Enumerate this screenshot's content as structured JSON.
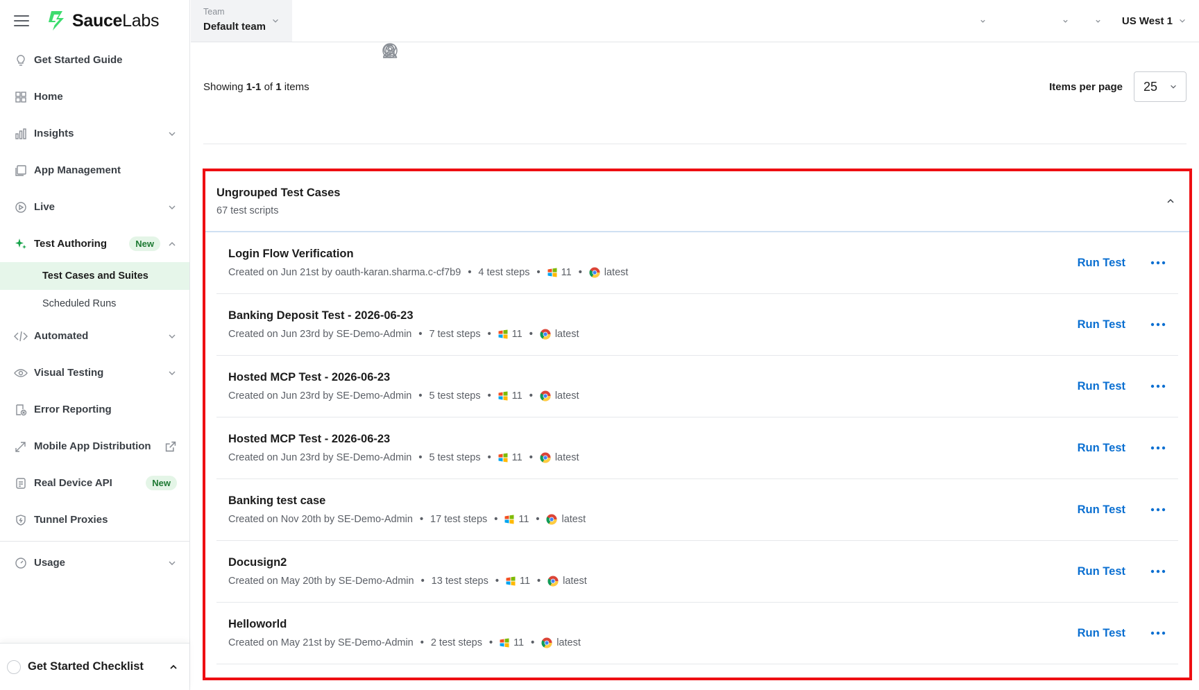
{
  "brand": {
    "name_prefix": "Sauce",
    "name_suffix": "Labs"
  },
  "sidebar": {
    "items": [
      {
        "label": "Get Started Guide"
      },
      {
        "label": "Home"
      },
      {
        "label": "Insights"
      },
      {
        "label": "App Management"
      },
      {
        "label": "Live"
      },
      {
        "label": "Test Authoring",
        "badge": "New"
      },
      {
        "label": "Automated"
      },
      {
        "label": "Visual Testing"
      },
      {
        "label": "Error Reporting"
      },
      {
        "label": "Mobile App Distribution"
      },
      {
        "label": "Real Device API",
        "badge": "New"
      },
      {
        "label": "Tunnel Proxies"
      },
      {
        "label": "Usage"
      }
    ],
    "sub_items": [
      {
        "label": "Test Cases and Suites",
        "active": true
      },
      {
        "label": "Scheduled Runs"
      }
    ],
    "checklist_label": "Get Started Checklist"
  },
  "topbar": {
    "team_label": "Team",
    "team_value": "Default team",
    "region": "US West 1"
  },
  "list": {
    "showing_prefix": "Showing",
    "range": "1-1",
    "of": "of",
    "total": "1",
    "items_word": "items",
    "items_per_page_label": "Items per page",
    "items_per_page_value": "25"
  },
  "group": {
    "title": "Ungrouped Test Cases",
    "subtitle": "67 test scripts"
  },
  "run_label": "Run Test",
  "tests": [
    {
      "name": "Login Flow Verification",
      "created": "Created on Jun 21st by oauth-karan.sharma.c-cf7b9",
      "steps": "4 test steps",
      "os": "11",
      "browser": "latest"
    },
    {
      "name": "Banking Deposit Test - 2026-06-23",
      "created": "Created on Jun 23rd by SE-Demo-Admin",
      "steps": "7 test steps",
      "os": "11",
      "browser": "latest"
    },
    {
      "name": "Hosted MCP Test - 2026-06-23",
      "created": "Created on Jun 23rd by SE-Demo-Admin",
      "steps": "5 test steps",
      "os": "11",
      "browser": "latest"
    },
    {
      "name": "Hosted MCP Test - 2026-06-23",
      "created": "Created on Jun 23rd by SE-Demo-Admin",
      "steps": "5 test steps",
      "os": "11",
      "browser": "latest"
    },
    {
      "name": "Banking test case",
      "created": "Created on Nov 20th by SE-Demo-Admin",
      "steps": "17 test steps",
      "os": "11",
      "browser": "latest"
    },
    {
      "name": "Docusign2",
      "created": "Created on May 20th by SE-Demo-Admin",
      "steps": "13 test steps",
      "os": "11",
      "browser": "latest"
    },
    {
      "name": "Helloworld",
      "created": "Created on May 21st by SE-Demo-Admin",
      "steps": "2 test steps",
      "os": "11",
      "browser": "latest"
    }
  ],
  "colors": {
    "accent": "#3ddc6e",
    "link": "#0a6fd1",
    "highlight": "#ee0e12",
    "active_bg": "#e6f6ea"
  },
  "icons": [
    "menu-icon",
    "lightbulb-icon",
    "grid-icon",
    "bar-chart-icon",
    "app-icon",
    "play-icon",
    "sparkle-icon",
    "code-icon",
    "eye-icon",
    "error-icon",
    "share-icon",
    "external-link-icon",
    "api-icon",
    "shield-icon",
    "gauge-icon",
    "key-icon",
    "search-icon",
    "bell-icon",
    "help-icon",
    "user-icon",
    "windows-icon",
    "chrome-icon",
    "more-icon"
  ]
}
